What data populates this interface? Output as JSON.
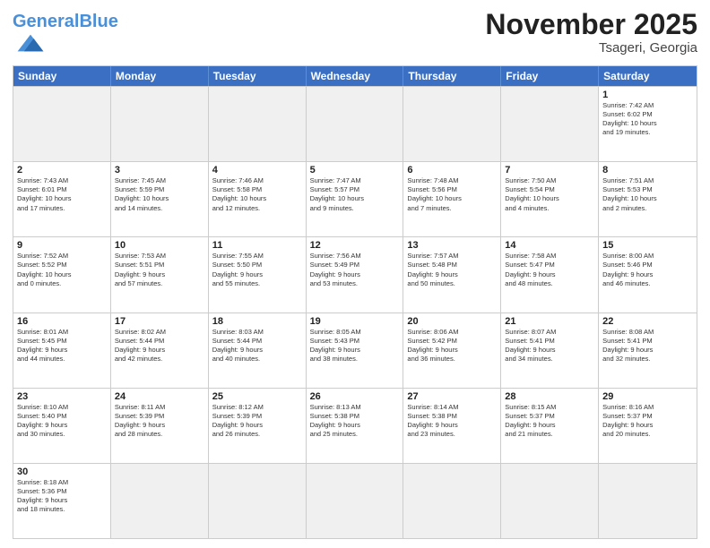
{
  "header": {
    "logo_general": "General",
    "logo_blue": "Blue",
    "month_title": "November 2025",
    "subtitle": "Tsageri, Georgia"
  },
  "weekdays": [
    "Sunday",
    "Monday",
    "Tuesday",
    "Wednesday",
    "Thursday",
    "Friday",
    "Saturday"
  ],
  "rows": [
    [
      {
        "day": "",
        "info": "",
        "empty": true
      },
      {
        "day": "",
        "info": "",
        "empty": true
      },
      {
        "day": "",
        "info": "",
        "empty": true
      },
      {
        "day": "",
        "info": "",
        "empty": true
      },
      {
        "day": "",
        "info": "",
        "empty": true
      },
      {
        "day": "",
        "info": "",
        "empty": true
      },
      {
        "day": "1",
        "info": "Sunrise: 7:42 AM\nSunset: 6:02 PM\nDaylight: 10 hours\nand 19 minutes."
      }
    ],
    [
      {
        "day": "2",
        "info": "Sunrise: 7:43 AM\nSunset: 6:01 PM\nDaylight: 10 hours\nand 17 minutes."
      },
      {
        "day": "3",
        "info": "Sunrise: 7:45 AM\nSunset: 5:59 PM\nDaylight: 10 hours\nand 14 minutes."
      },
      {
        "day": "4",
        "info": "Sunrise: 7:46 AM\nSunset: 5:58 PM\nDaylight: 10 hours\nand 12 minutes."
      },
      {
        "day": "5",
        "info": "Sunrise: 7:47 AM\nSunset: 5:57 PM\nDaylight: 10 hours\nand 9 minutes."
      },
      {
        "day": "6",
        "info": "Sunrise: 7:48 AM\nSunset: 5:56 PM\nDaylight: 10 hours\nand 7 minutes."
      },
      {
        "day": "7",
        "info": "Sunrise: 7:50 AM\nSunset: 5:54 PM\nDaylight: 10 hours\nand 4 minutes."
      },
      {
        "day": "8",
        "info": "Sunrise: 7:51 AM\nSunset: 5:53 PM\nDaylight: 10 hours\nand 2 minutes."
      }
    ],
    [
      {
        "day": "9",
        "info": "Sunrise: 7:52 AM\nSunset: 5:52 PM\nDaylight: 10 hours\nand 0 minutes."
      },
      {
        "day": "10",
        "info": "Sunrise: 7:53 AM\nSunset: 5:51 PM\nDaylight: 9 hours\nand 57 minutes."
      },
      {
        "day": "11",
        "info": "Sunrise: 7:55 AM\nSunset: 5:50 PM\nDaylight: 9 hours\nand 55 minutes."
      },
      {
        "day": "12",
        "info": "Sunrise: 7:56 AM\nSunset: 5:49 PM\nDaylight: 9 hours\nand 53 minutes."
      },
      {
        "day": "13",
        "info": "Sunrise: 7:57 AM\nSunset: 5:48 PM\nDaylight: 9 hours\nand 50 minutes."
      },
      {
        "day": "14",
        "info": "Sunrise: 7:58 AM\nSunset: 5:47 PM\nDaylight: 9 hours\nand 48 minutes."
      },
      {
        "day": "15",
        "info": "Sunrise: 8:00 AM\nSunset: 5:46 PM\nDaylight: 9 hours\nand 46 minutes."
      }
    ],
    [
      {
        "day": "16",
        "info": "Sunrise: 8:01 AM\nSunset: 5:45 PM\nDaylight: 9 hours\nand 44 minutes."
      },
      {
        "day": "17",
        "info": "Sunrise: 8:02 AM\nSunset: 5:44 PM\nDaylight: 9 hours\nand 42 minutes."
      },
      {
        "day": "18",
        "info": "Sunrise: 8:03 AM\nSunset: 5:44 PM\nDaylight: 9 hours\nand 40 minutes."
      },
      {
        "day": "19",
        "info": "Sunrise: 8:05 AM\nSunset: 5:43 PM\nDaylight: 9 hours\nand 38 minutes."
      },
      {
        "day": "20",
        "info": "Sunrise: 8:06 AM\nSunset: 5:42 PM\nDaylight: 9 hours\nand 36 minutes."
      },
      {
        "day": "21",
        "info": "Sunrise: 8:07 AM\nSunset: 5:41 PM\nDaylight: 9 hours\nand 34 minutes."
      },
      {
        "day": "22",
        "info": "Sunrise: 8:08 AM\nSunset: 5:41 PM\nDaylight: 9 hours\nand 32 minutes."
      }
    ],
    [
      {
        "day": "23",
        "info": "Sunrise: 8:10 AM\nSunset: 5:40 PM\nDaylight: 9 hours\nand 30 minutes."
      },
      {
        "day": "24",
        "info": "Sunrise: 8:11 AM\nSunset: 5:39 PM\nDaylight: 9 hours\nand 28 minutes."
      },
      {
        "day": "25",
        "info": "Sunrise: 8:12 AM\nSunset: 5:39 PM\nDaylight: 9 hours\nand 26 minutes."
      },
      {
        "day": "26",
        "info": "Sunrise: 8:13 AM\nSunset: 5:38 PM\nDaylight: 9 hours\nand 25 minutes."
      },
      {
        "day": "27",
        "info": "Sunrise: 8:14 AM\nSunset: 5:38 PM\nDaylight: 9 hours\nand 23 minutes."
      },
      {
        "day": "28",
        "info": "Sunrise: 8:15 AM\nSunset: 5:37 PM\nDaylight: 9 hours\nand 21 minutes."
      },
      {
        "day": "29",
        "info": "Sunrise: 8:16 AM\nSunset: 5:37 PM\nDaylight: 9 hours\nand 20 minutes."
      }
    ],
    [
      {
        "day": "30",
        "info": "Sunrise: 8:18 AM\nSunset: 5:36 PM\nDaylight: 9 hours\nand 18 minutes."
      },
      {
        "day": "",
        "info": "",
        "empty": true
      },
      {
        "day": "",
        "info": "",
        "empty": true
      },
      {
        "day": "",
        "info": "",
        "empty": true
      },
      {
        "day": "",
        "info": "",
        "empty": true
      },
      {
        "day": "",
        "info": "",
        "empty": true
      },
      {
        "day": "",
        "info": "",
        "empty": true
      }
    ]
  ]
}
